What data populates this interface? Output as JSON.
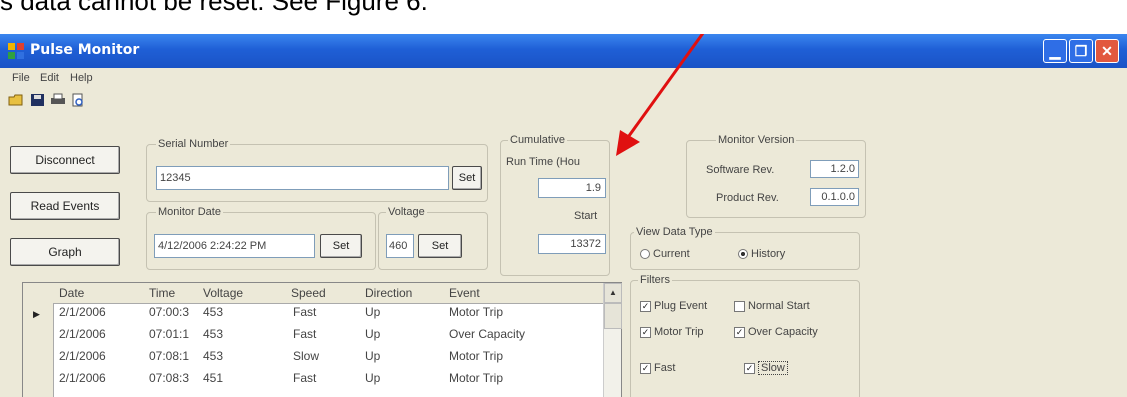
{
  "caption": "s data cannot be reset. See Figure 6.",
  "window": {
    "title": "Pulse Monitor",
    "menu": [
      "File",
      "Edit",
      "Help"
    ]
  },
  "buttons": {
    "disconnect": "Disconnect",
    "read_events": "Read Events",
    "graph": "Graph",
    "set": "Set"
  },
  "serial": {
    "label": "Serial Number",
    "value": "12345"
  },
  "monitor_date": {
    "label": "Monitor Date",
    "value": "4/12/2006 2:24:22 PM"
  },
  "voltage": {
    "label": "Voltage",
    "value": "460"
  },
  "cumulative": {
    "label": "Cumulative",
    "run_time_label": "Run Time (Hou",
    "run_time_value": "1.9",
    "start_label": "Start",
    "start_value": "13372"
  },
  "monitor_version": {
    "label": "Monitor Version",
    "software_label": "Software Rev.",
    "software_value": "1.2.0",
    "product_label": "Product Rev.",
    "product_value": "0.1.0.0"
  },
  "view_data_type": {
    "label": "View Data Type",
    "options": [
      "Current",
      "History"
    ],
    "selected": "History"
  },
  "filters": {
    "label": "Filters",
    "items": [
      {
        "label": "Plug Event",
        "checked": true
      },
      {
        "label": "Normal Start",
        "checked": false
      },
      {
        "label": "Motor Trip",
        "checked": true
      },
      {
        "label": "Over Capacity",
        "checked": true
      },
      {
        "label": "Fast",
        "checked": true
      },
      {
        "label": "Slow",
        "checked": true
      }
    ]
  },
  "table": {
    "columns": [
      "Date",
      "Time",
      "Voltage",
      "Speed",
      "Direction",
      "Event"
    ],
    "rows": [
      [
        "2/1/2006",
        "07:00:3",
        "453",
        "Fast",
        "Up",
        "Motor Trip"
      ],
      [
        "2/1/2006",
        "07:01:1",
        "453",
        "Fast",
        "Up",
        "Over Capacity"
      ],
      [
        "2/1/2006",
        "07:08:1",
        "453",
        "Slow",
        "Up",
        "Motor Trip"
      ],
      [
        "2/1/2006",
        "07:08:3",
        "451",
        "Fast",
        "Up",
        "Motor Trip"
      ]
    ]
  },
  "colors": {
    "titlebar": "#1f5fd6",
    "window_bg": "#ece9d8",
    "arrow": "#e01010"
  }
}
